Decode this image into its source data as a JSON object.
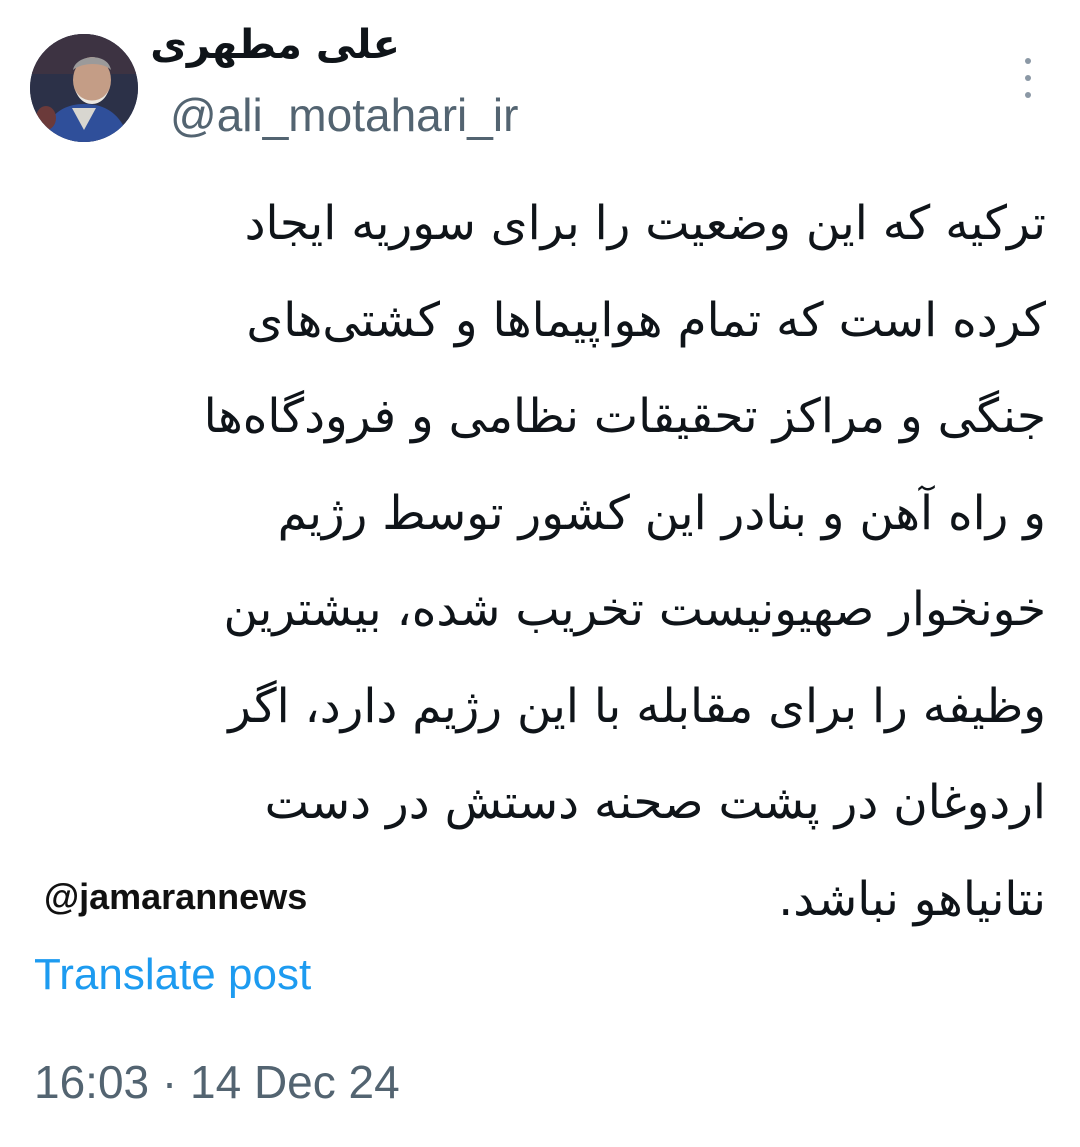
{
  "author": {
    "display_name": "علی مطهری",
    "handle": "@ali_motahari_ir"
  },
  "post": {
    "lines": [
      "ترکیه که این وضعیت را برای سوریه ایجاد",
      "کرده است که تمام هواپیماها و کشتی‌های",
      "جنگی و مراکز تحقیقات نظامی و فرودگاه‌ها",
      "و راه آهن و بنادر این کشور توسط رژیم",
      "خونخوار صهیونیست تخریب شده، بیشترین",
      "وظیفه را برای مقابله با این رژیم دارد، اگر",
      "اردوغان در پشت صحنه دستش در دست",
      "نتانیاهو نباشد."
    ],
    "watermark": "@jamarannews",
    "translate_label": "Translate post",
    "timestamp": "16:03 · 14 Dec 24"
  },
  "icons": {
    "more": "more-vertical-icon",
    "avatar": "avatar-photo"
  },
  "colors": {
    "link": "#1d9bf0",
    "secondary_text": "#536471",
    "primary_text": "#0f1419"
  }
}
